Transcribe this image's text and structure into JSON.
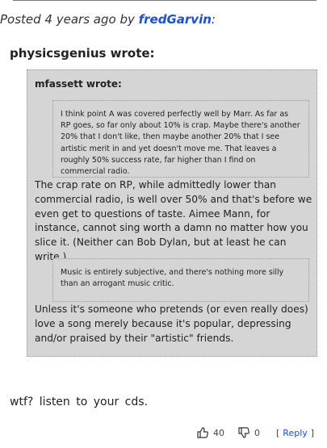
{
  "post": {
    "posted_prefix": "Posted 4 years ago by ",
    "author": "fredGarvin",
    "posted_suffix": ":"
  },
  "quote": {
    "outer_author_line": "physicsgenius wrote:",
    "inner_author_line": "mfassett wrote:",
    "inner_quote": "I think point A was covered perfectly well by Marr. As far as RP goes, so far only about 10% is crap. Maybe there's another 20% that I don't like, then maybe another 20% that I see artistic merit in and yet doesn't move me. That leaves a roughly 50% success rate, far higher than I find on commercial radio.",
    "reply_part1": "The crap rate on RP, while admittedly lower than commercial radio, is well over 50% and that's before we even get to questions of taste. Aimee Mann, for instance, cannot sing worth a damn no matter how you slice it. (Neither can Bob Dylan, but at least he can write.)",
    "inner_quote2": "Music is entirely subjective, and there's nothing more silly than an arrogant music critic.",
    "reply_part2": "Unless it's someone who pretends (or even really does) love a song merely because it's popular, depressing and/or praised by their \"artistic\" friends."
  },
  "reply": {
    "text": "wtf?  listen to your cds."
  },
  "actions": {
    "like_count": "40",
    "dislike_count": "0",
    "reply_open": "[",
    "reply_label": "Reply",
    "reply_close": "]"
  },
  "icons": {
    "like": "thumbs-up-icon",
    "dislike": "thumbs-down-icon"
  },
  "colors": {
    "link": "#1a4fd6",
    "quote_bg": "#d5d5d5"
  }
}
